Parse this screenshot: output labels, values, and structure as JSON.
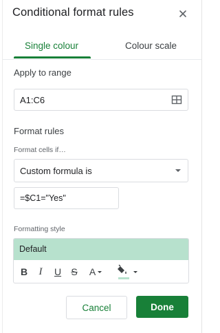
{
  "header": {
    "title": "Conditional format rules",
    "close_icon": "close-icon"
  },
  "tabs": [
    {
      "label": "Single colour",
      "active": true
    },
    {
      "label": "Colour scale",
      "active": false
    }
  ],
  "apply_range": {
    "label": "Apply to range",
    "value": "A1:C6",
    "icon": "grid-select-icon"
  },
  "format_rules": {
    "label": "Format rules",
    "condition_label": "Format cells if…",
    "condition_value": "Custom formula is",
    "formula_value": "=$C1=\"Yes\""
  },
  "formatting_style": {
    "label": "Formatting style",
    "preview_label": "Default",
    "preview_color": "#b7e1cd",
    "toolbar": {
      "bold": "B",
      "italic": "I",
      "underline": "U",
      "strikethrough": "S",
      "text_color": "A",
      "fill_icon": "paint-bucket-icon"
    }
  },
  "actions": {
    "cancel": "Cancel",
    "done": "Done"
  },
  "colors": {
    "accent": "#188038",
    "preview_fill": "#b7e1cd"
  }
}
